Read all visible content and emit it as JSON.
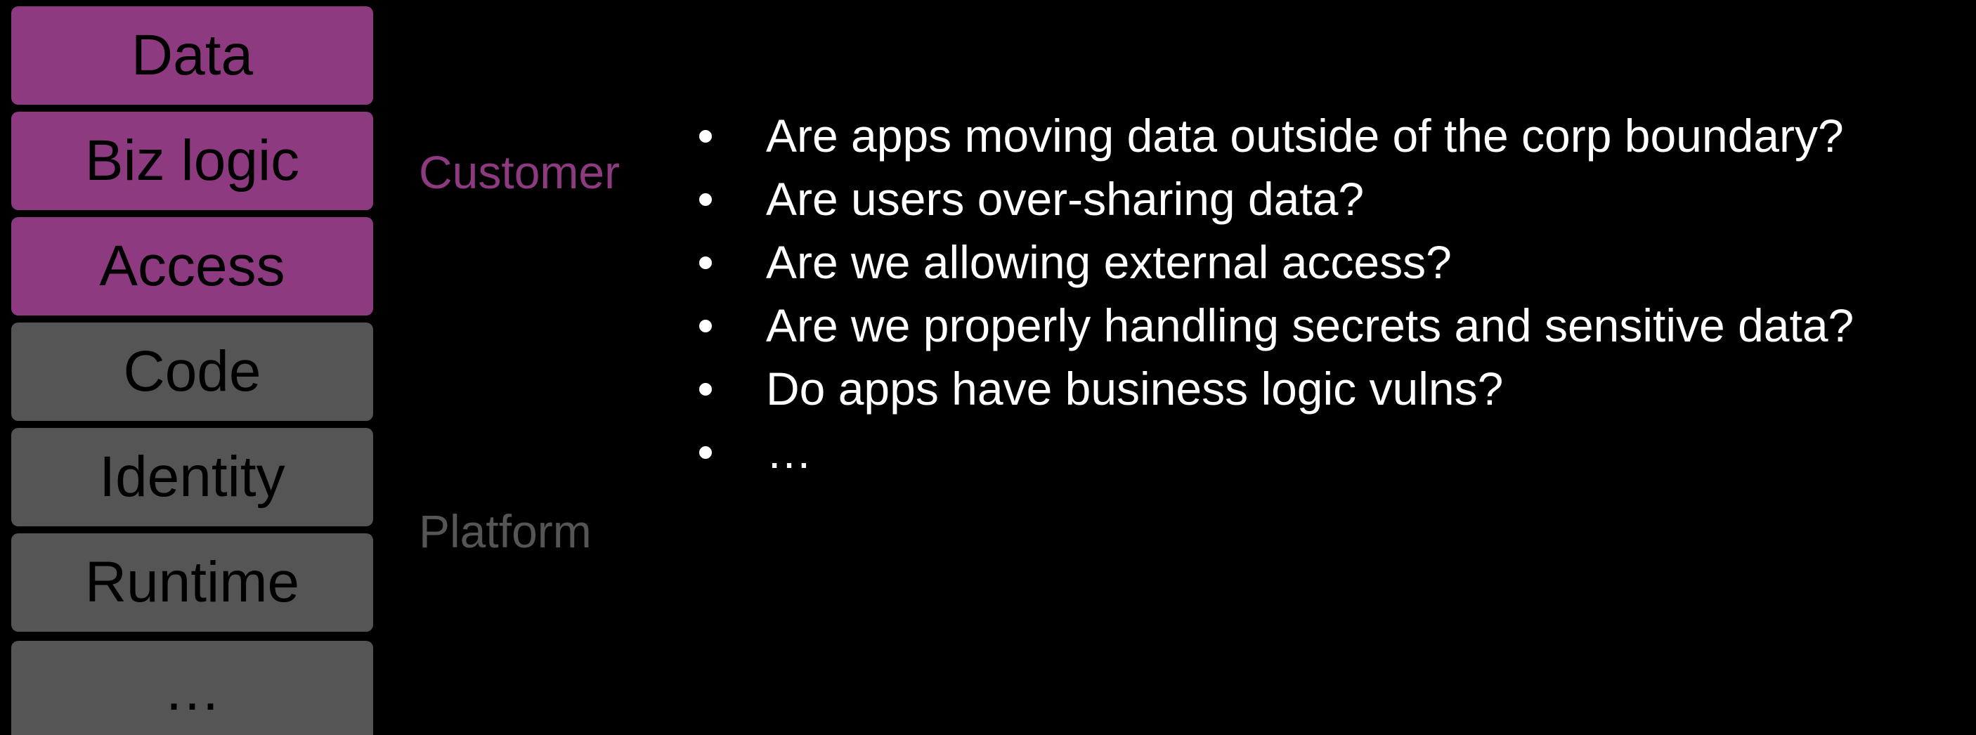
{
  "stack": {
    "layers": [
      {
        "label": "Data",
        "group": "customer"
      },
      {
        "label": "Biz logic",
        "group": "customer"
      },
      {
        "label": "Access",
        "group": "customer"
      },
      {
        "label": "Code",
        "group": "platform"
      },
      {
        "label": "Identity",
        "group": "platform"
      },
      {
        "label": "Runtime",
        "group": "platform"
      },
      {
        "label": "…",
        "group": "platform"
      }
    ]
  },
  "groups": {
    "customer": {
      "label": "Customer",
      "color": "#8e3a80"
    },
    "platform": {
      "label": "Platform",
      "color": "#555555"
    }
  },
  "bullets": [
    "Are apps moving data outside of the corp boundary?",
    "Are users over-sharing data?",
    "Are we allowing external access?",
    "Are we properly handling secrets and sensitive data?",
    "Do apps have business logic vulns?",
    "…"
  ]
}
